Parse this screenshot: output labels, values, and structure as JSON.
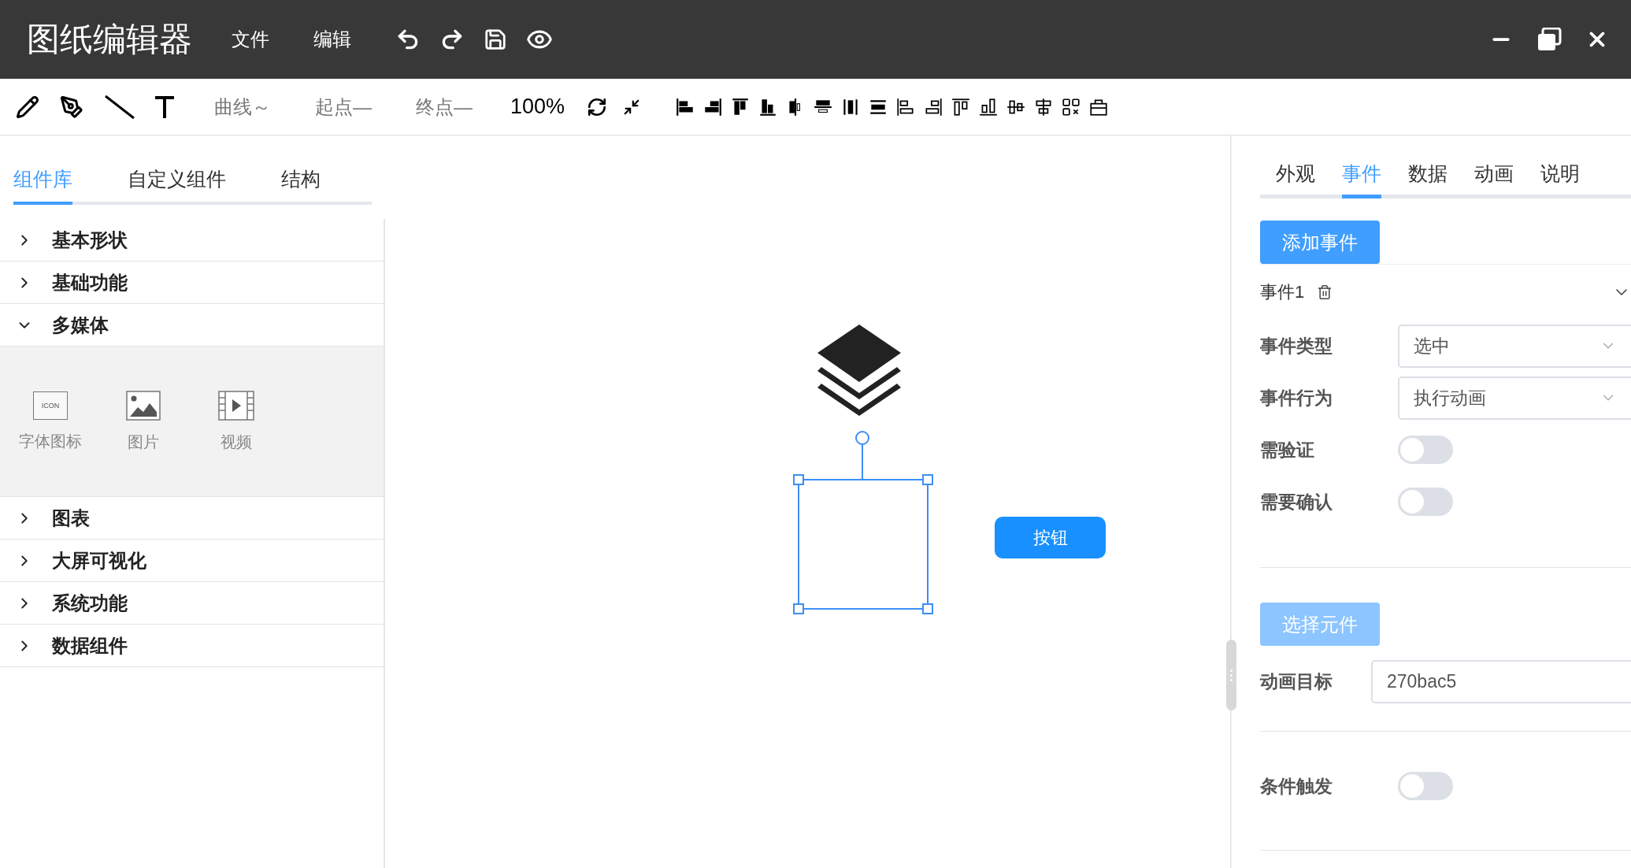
{
  "app": {
    "title": "图纸编辑器",
    "menu": [
      {
        "label": "文件"
      },
      {
        "label": "编辑"
      }
    ]
  },
  "toolbar": {
    "texts": [
      {
        "kind": "muted",
        "label": "曲线～"
      },
      {
        "kind": "muted",
        "label": "起点—"
      },
      {
        "kind": "muted",
        "label": "终点—"
      },
      {
        "kind": "plain",
        "label": "100%"
      }
    ]
  },
  "left_panel": {
    "tabs": [
      {
        "label": "组件库",
        "selected": true
      },
      {
        "label": "自定义组件",
        "selected": false
      },
      {
        "label": "结构",
        "selected": false
      }
    ],
    "categories": [
      {
        "label": "基本形状",
        "expanded": false
      },
      {
        "label": "基础功能",
        "expanded": false
      },
      {
        "label": "多媒体",
        "expanded": true,
        "items": [
          {
            "kind": "icon",
            "label": "字体图标",
            "badge": "ICON"
          },
          {
            "kind": "image",
            "label": "图片"
          },
          {
            "kind": "video",
            "label": "视频"
          }
        ]
      },
      {
        "label": "图表",
        "expanded": false
      },
      {
        "label": "大屏可视化",
        "expanded": false
      },
      {
        "label": "系统功能",
        "expanded": false
      },
      {
        "label": "数据组件",
        "expanded": false
      }
    ]
  },
  "canvas": {
    "button": {
      "label": "按钮"
    }
  },
  "right_panel": {
    "tabs": [
      {
        "label": "外观",
        "selected": false
      },
      {
        "label": "事件",
        "selected": true
      },
      {
        "label": "数据",
        "selected": false
      },
      {
        "label": "动画",
        "selected": false
      },
      {
        "label": "说明",
        "selected": false
      }
    ],
    "add_button": {
      "label": "添加事件",
      "disabled": false
    },
    "event": {
      "title": "事件1",
      "expanded": true,
      "fields": [
        {
          "kind": "select",
          "label": "事件类型",
          "value": "选中"
        },
        {
          "kind": "select",
          "label": "事件行为",
          "value": "执行动画"
        },
        {
          "kind": "toggle",
          "label": "需验证",
          "on": false
        },
        {
          "kind": "toggle",
          "label": "需要确认",
          "on": false
        }
      ]
    },
    "target_button": {
      "label": "选择元件",
      "disabled": true
    },
    "target_fields": [
      {
        "kind": "input",
        "label": "动画目标",
        "value": "270bac5"
      }
    ],
    "condition_fields": [
      {
        "kind": "toggle",
        "label": "条件触发",
        "on": false
      }
    ]
  }
}
